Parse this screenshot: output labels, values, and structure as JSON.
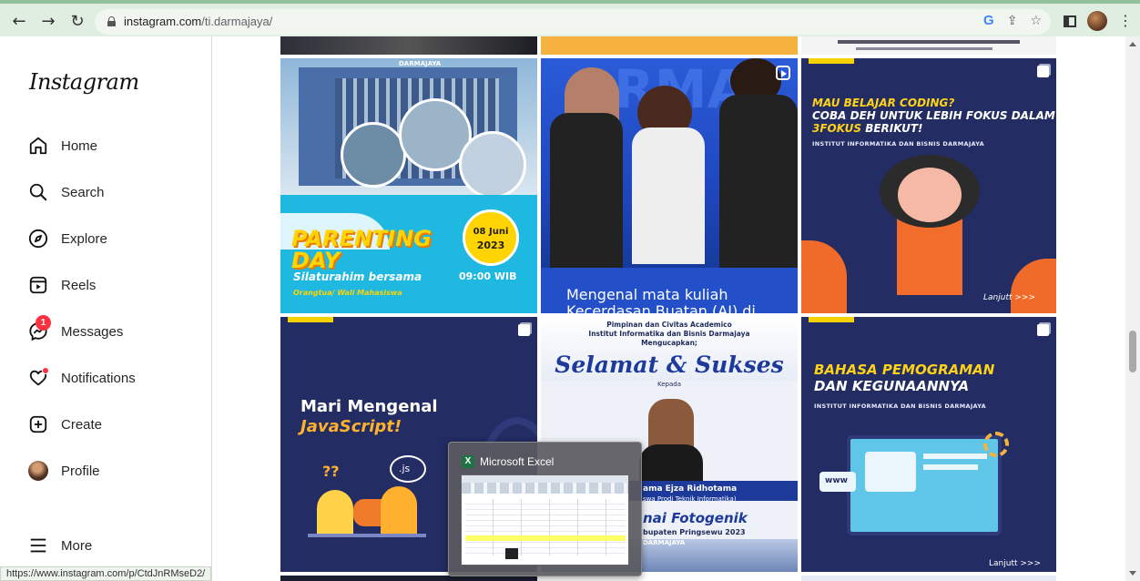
{
  "browser": {
    "url_host": "instagram.com",
    "url_path": "/ti.darmajaya/",
    "status_url": "https://www.instagram.com/p/CtdJnRMseD2/"
  },
  "sidebar": {
    "logo": "Instagram",
    "items": [
      {
        "label": "Home",
        "icon": "home-icon"
      },
      {
        "label": "Search",
        "icon": "search-icon"
      },
      {
        "label": "Explore",
        "icon": "compass-icon"
      },
      {
        "label": "Reels",
        "icon": "reels-icon"
      },
      {
        "label": "Messages",
        "icon": "messenger-icon",
        "badge": "1"
      },
      {
        "label": "Notifications",
        "icon": "heart-icon"
      },
      {
        "label": "Create",
        "icon": "plus-square-icon"
      },
      {
        "label": "Profile",
        "icon": "avatar"
      },
      {
        "label": "More",
        "icon": "hamburger-icon"
      }
    ]
  },
  "posts": {
    "p1": {
      "title": "PARENTING DAY",
      "date_line1": "08 Juni",
      "date_line2": "2023",
      "time": "09:00 WIB",
      "line1": "Silaturahim bersama",
      "line2": "Orangtua/ Wali Mahasiswa",
      "banner": "DARMAJAYA"
    },
    "p2": {
      "caption_line1": "Mengenal mata kuliah",
      "caption_line2": "Kecerdasan Buatan (AI) di",
      "banner": "RMA"
    },
    "p3": {
      "line1": "MAU BELAJAR CODING?",
      "line2": "COBA DEH UNTUK LEBIH FOKUS DALAM",
      "line3_a": "3FOKUS",
      "line3_b": " BERIKUT!",
      "sub": "INSTITUT INFORMATIKA DAN BISNIS DARMAJAYA",
      "more": "Lanjutt >>>"
    },
    "p4": {
      "line1": "Mari Mengenal",
      "line2": "JavaScript!",
      "js": ".js",
      "q": "??"
    },
    "p5": {
      "top1": "Pimpinan dan Civitas Academico",
      "top2": "Institut Informatika dan Bisnis Darmajaya",
      "top3": "Mengucapkan;",
      "title": "Selamat & Sukses",
      "kepada": "Kepada",
      "name": "ama Ejza Ridhotama",
      "prodi": "swa Prodi Teknik Informatika)",
      "award": "nai Fotogenik",
      "place": "bupaten Pringsewu 2023",
      "banner": "DARMAJAYA"
    },
    "p6": {
      "line1": "BAHASA PEMOGRAMAN",
      "line2": "DAN KEGUNAANNYA",
      "sub": "INSTITUT INFORMATIKA DAN BISNIS DARMAJAYA",
      "www": "www",
      "more": "Lanjutt >>>"
    }
  },
  "taskbar_preview": {
    "app_name": "Microsoft Excel"
  }
}
